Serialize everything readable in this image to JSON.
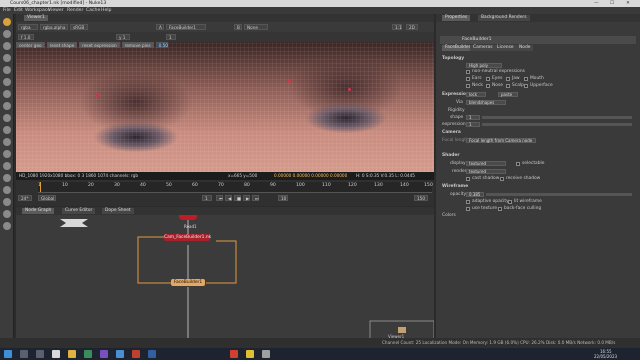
{
  "window": {
    "title": "Cours06_chapter1.nk [modified] - Nuke13",
    "controls": [
      "—",
      "☐",
      "✕"
    ]
  },
  "menu": [
    "File",
    "Edit",
    "Workspace",
    "Viewer",
    "Render",
    "Cache",
    "Help"
  ],
  "viewer": {
    "tab": "Viewer1",
    "toolbar": {
      "channels": "rgba",
      "alpha": "rgba.alpha",
      "rgb": "sRGB",
      "input_a": "A",
      "node_a": "FaceBuilder1",
      "input_b": "B",
      "none": "None",
      "zoom": "1",
      "aspect": "1:1",
      "mode": "3D",
      "view": "2D",
      "gain": "f 1.0",
      "gamma": "y 1",
      "frame": "1"
    },
    "overlay_buttons": [
      "center geo",
      "reset shape",
      "reset expression",
      "remove pins"
    ],
    "overlay_value": "0.50",
    "info_left": "HD_1080 1920x1080 bbox: 0 3 1860 1074 channels: rgb",
    "info_coords": "x=665 y=500",
    "info_values": "0.00000  0.00000  0.00000  0.00000",
    "info_right": "H: 0  S:0.35 V:0.35  L: 0.0445"
  },
  "timeline": {
    "ticks": [
      "1",
      "10",
      "20",
      "30",
      "40",
      "50",
      "60",
      "70",
      "80",
      "90",
      "100",
      "110",
      "120",
      "130",
      "140",
      "150"
    ],
    "fps": "24*",
    "scope": "Global",
    "frame": "1",
    "end": "150",
    "step": "10"
  },
  "nodegraph": {
    "tabs": [
      "Node Graph",
      "Curve Editor",
      "Dope Sheet"
    ],
    "nodes": {
      "read": "Read1",
      "cam": "Cam_FaceBuilder1.nk",
      "fb": "FaceBuilder1",
      "view": "Viewer1"
    }
  },
  "properties": {
    "tabs": [
      "Properties",
      "Background Renders"
    ],
    "node_name": "FaceBuilder1",
    "node_tabs": [
      "FaceBuilder",
      "Cameras",
      "License",
      "Node"
    ],
    "topology": {
      "label": "Topology",
      "level": "High poly",
      "neutral": "non-neutral expressions",
      "parts": [
        "Ears",
        "Eyes",
        "Jaw",
        "Mouth",
        "Neck",
        "Nose",
        "Scalp",
        "Upperface"
      ]
    },
    "expression": {
      "label": "Expression",
      "buttons": [
        "lock",
        "paste"
      ],
      "mode_label": "Via",
      "mode": "blendshapes",
      "rigidity_label": "Rigidity",
      "shape_label": "shape",
      "shape_val": "1",
      "expr_label": "expression",
      "expr_val": "1"
    },
    "camera": {
      "label": "Camera",
      "focal_label": "Focal length",
      "focal": "Focal length from Camera node"
    },
    "shader": {
      "label": "Shader",
      "display_label": "display",
      "display": "textured",
      "selectable": "selectable",
      "render_label": "render",
      "render": "textured",
      "cast": "cast shadow",
      "receive": "receive shadow"
    },
    "wireframe": {
      "label": "Wireframe",
      "opacity_label": "opacity",
      "opacity": "0.385",
      "adaptive": "adaptive opacity",
      "lit": "lit wireframe",
      "use_tex": "use texture",
      "backface": "back-face culling"
    },
    "colors": "Colors"
  },
  "status": {
    "text": "Channel Count: 25  Localization Mode: On  Memory: 1.9 GB (6.0%)  CPU: 26.2%  Disk: 0.0 MB/s  Network: 0.0 MB/s"
  },
  "taskbar": {
    "time": "16:55",
    "date": "22/05/2023"
  }
}
